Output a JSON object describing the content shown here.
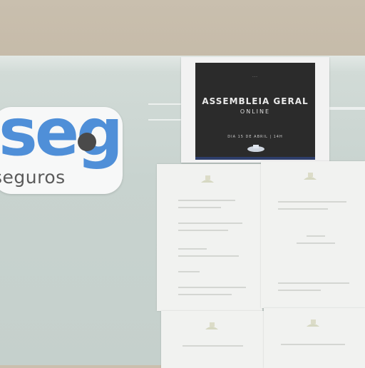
{
  "logo": {
    "wordmark": "seg",
    "subtitle": "seguros"
  },
  "poster": {
    "header": "...",
    "title": "ASSEMBLEIA GERAL",
    "subtitle": "ONLINE",
    "date": "DIA 15 DE ABRIL | 14H"
  },
  "colors": {
    "brand": "#4f8fd8",
    "board": "#c8d3cf",
    "wall": "#c9bfae",
    "poster_bg": "#2b2b2b"
  }
}
